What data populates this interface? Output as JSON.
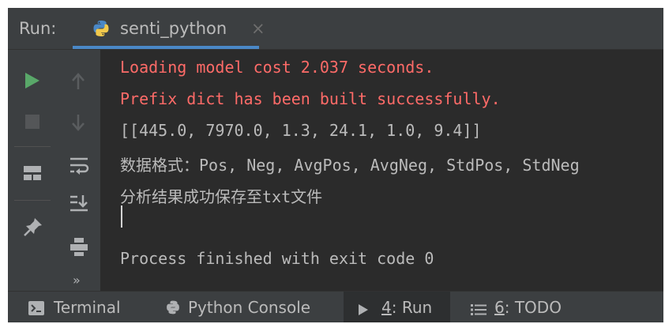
{
  "header": {
    "run_label": "Run:",
    "tab": {
      "title": "senti_python",
      "close_glyph": "×"
    }
  },
  "toolbar": {
    "left": [
      "play-icon",
      "stop-icon",
      "layout-icon",
      "pin-icon"
    ],
    "right": [
      "arrow-up-icon",
      "arrow-down-icon",
      "soft-wrap-icon",
      "scroll-to-end-icon",
      "print-icon",
      "more-icon"
    ],
    "more_glyph": "»"
  },
  "console": {
    "lines": [
      {
        "text": "Loading model cost 2.037 seconds.",
        "style": "error"
      },
      {
        "text": "Prefix dict has been built successfully.",
        "style": "error"
      },
      {
        "text": "[[445.0, 7970.0, 1.3, 24.1, 1.0, 9.4]]",
        "style": "normal"
      },
      {
        "text": "数据格式：Pos, Neg, AvgPos, AvgNeg, StdPos, StdNeg",
        "style": "normal"
      },
      {
        "text": "分析结果成功保存至txt文件",
        "style": "normal"
      },
      {
        "text": "",
        "style": "cursor"
      },
      {
        "text": "Process finished with exit code 0",
        "style": "normal"
      }
    ]
  },
  "bottom_bar": {
    "terminal": "Terminal",
    "python_console": "Python Console",
    "run": {
      "mnemonic": "4",
      "label": ": Run"
    },
    "todo": {
      "mnemonic": "6",
      "label": ": TODO"
    }
  },
  "colors": {
    "error_text": "#ff6b68",
    "normal_text": "#bbbbbb",
    "accent": "#4a88c7",
    "run_green": "#59a869"
  }
}
